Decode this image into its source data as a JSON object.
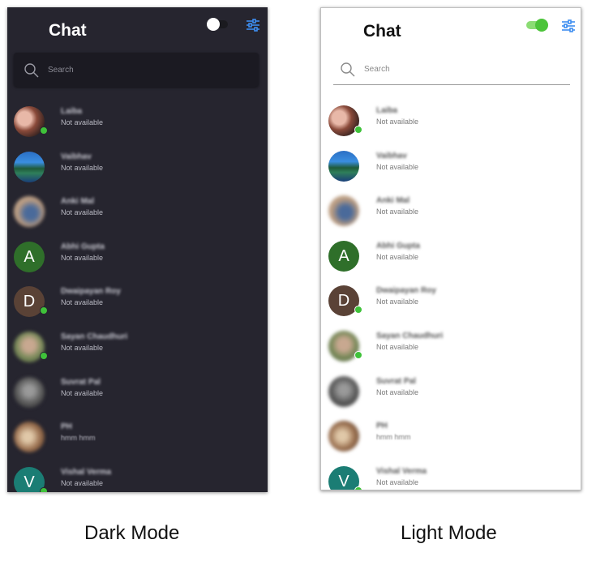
{
  "app": {
    "title": "Chat"
  },
  "search": {
    "placeholder": "Search"
  },
  "captions": {
    "dark": "Dark Mode",
    "light": "Light Mode"
  },
  "colors": {
    "dark_bg": "#26252f",
    "online": "#3fc23a",
    "accent": "#3d8ef0"
  },
  "icons": {
    "search": "search-icon",
    "filter": "filter-sliders-icon",
    "toggle": "theme-toggle"
  },
  "toggle": {
    "dark_mode_on": false,
    "light_mode_on": true
  },
  "contacts": [
    {
      "name": "Laiba",
      "status": "Not available",
      "online": true,
      "avatar": {
        "type": "photo",
        "style": "portrait"
      }
    },
    {
      "name": "Vaibhav",
      "status": "Not available",
      "online": false,
      "avatar": {
        "type": "photo",
        "style": "landscape"
      }
    },
    {
      "name": "Anki Mal",
      "status": "Not available",
      "online": false,
      "avatar": {
        "type": "photo",
        "style": "blurred-blue"
      }
    },
    {
      "name": "Abhi Gupta",
      "status": "Not available",
      "online": false,
      "avatar": {
        "type": "letter",
        "letter": "A",
        "color": "#2f6f2a"
      }
    },
    {
      "name": "Dwaipayan Roy",
      "status": "Not available",
      "online": true,
      "avatar": {
        "type": "letter",
        "letter": "D",
        "color": "#5a4236"
      }
    },
    {
      "name": "Sayan Chaudhuri",
      "status": "Not available",
      "online": true,
      "avatar": {
        "type": "photo",
        "style": "blurred-green"
      }
    },
    {
      "name": "Suvrat Pal",
      "status": "Not available",
      "online": false,
      "avatar": {
        "type": "photo",
        "style": "blurred-dark"
      }
    },
    {
      "name": "PH",
      "status": "hmm hmm",
      "online": false,
      "avatar": {
        "type": "photo",
        "style": "blurred-brown"
      }
    },
    {
      "name": "Vishal Verma",
      "status": "Not available",
      "online": true,
      "avatar": {
        "type": "letter",
        "letter": "V",
        "color": "#1b7d74"
      }
    }
  ]
}
